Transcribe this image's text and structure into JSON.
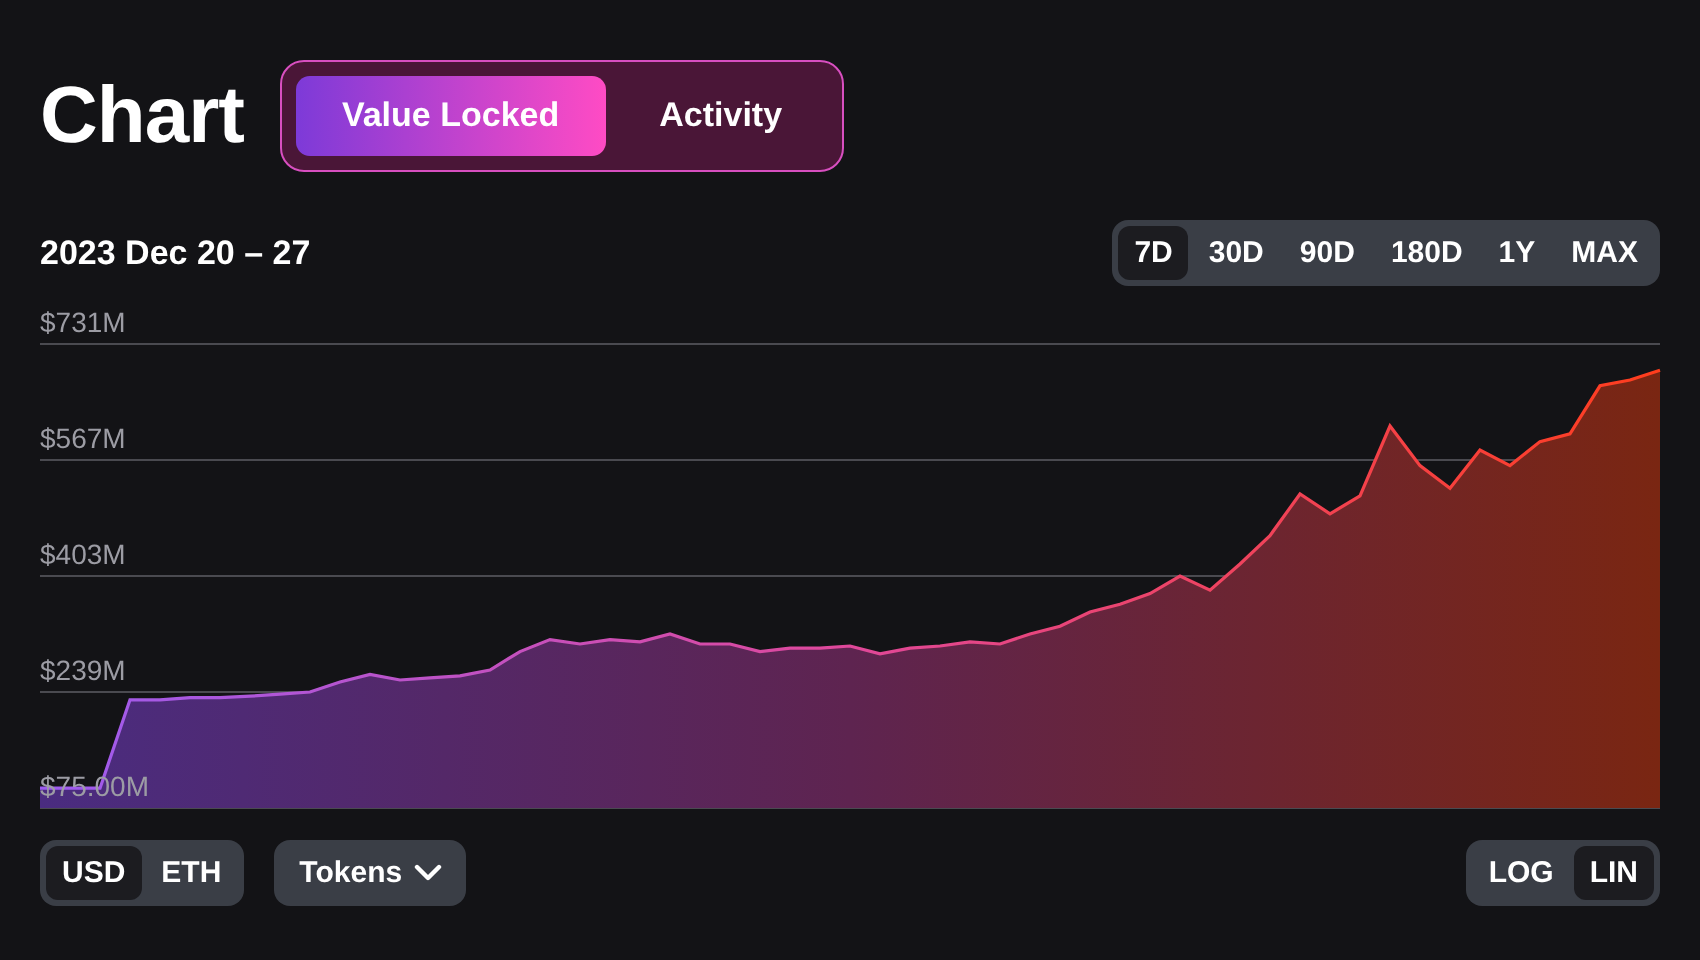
{
  "title": "Chart",
  "tabs": [
    {
      "label": "Value Locked",
      "selected": true
    },
    {
      "label": "Activity",
      "selected": false
    }
  ],
  "date_range": "2023 Dec 20 – 27",
  "ranges": [
    {
      "label": "7D",
      "selected": true
    },
    {
      "label": "30D",
      "selected": false
    },
    {
      "label": "90D",
      "selected": false
    },
    {
      "label": "180D",
      "selected": false
    },
    {
      "label": "1Y",
      "selected": false
    },
    {
      "label": "MAX",
      "selected": false
    }
  ],
  "chart": {
    "chart_data": {
      "type": "area",
      "grid": true,
      "ylim": [
        75,
        731
      ],
      "yticks": [
        {
          "value": 75,
          "label": "$75.00M"
        },
        {
          "value": 239,
          "label": "$239M"
        },
        {
          "value": 403,
          "label": "$403M"
        },
        {
          "value": 567,
          "label": "$567M"
        },
        {
          "value": 731,
          "label": "$731M"
        }
      ],
      "values": [
        103,
        103,
        103,
        228,
        228,
        231,
        231,
        233,
        236,
        239,
        253,
        264,
        256,
        259,
        262,
        270,
        296,
        313,
        307,
        313,
        310,
        321,
        307,
        307,
        296,
        301,
        301,
        304,
        293,
        301,
        304,
        310,
        307,
        321,
        332,
        352,
        363,
        378,
        403,
        383,
        420,
        460,
        519,
        491,
        516,
        615,
        559,
        527,
        581,
        559,
        593,
        604,
        672,
        680,
        694
      ]
    }
  },
  "currency": [
    {
      "label": "USD",
      "selected": true
    },
    {
      "label": "ETH",
      "selected": false
    }
  ],
  "tokens_button": {
    "label": "Tokens"
  },
  "scale": [
    {
      "label": "LOG",
      "selected": false
    },
    {
      "label": "LIN",
      "selected": true
    }
  ]
}
